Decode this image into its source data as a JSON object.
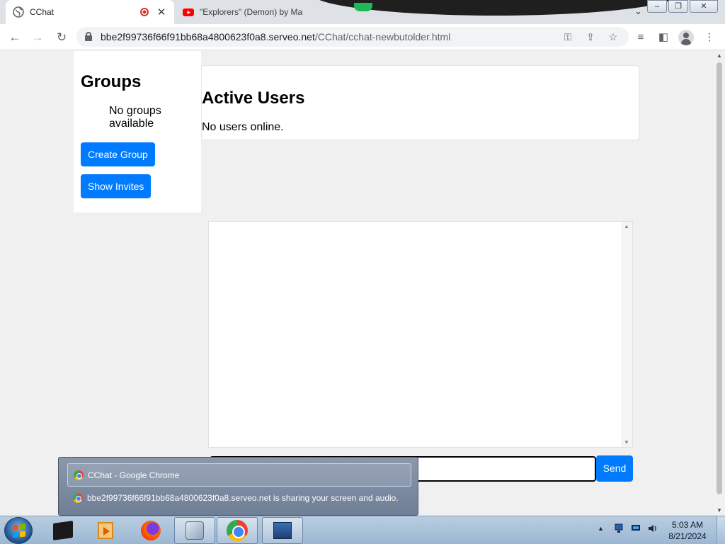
{
  "browser": {
    "tabs": [
      {
        "title": "CChat",
        "recording": true
      },
      {
        "title": "\"Explorers\" (Demon) by Ma"
      }
    ],
    "address": {
      "host": "bbe2f99736f66f91bb68a4800623f0a8.serveo.net",
      "path": "/CChat/cchat-newbutolder.html"
    }
  },
  "page": {
    "groups": {
      "title": "Groups",
      "empty_text": "No groups available",
      "create_label": "Create Group",
      "invites_label": "Show Invites"
    },
    "users": {
      "title": "Active Users",
      "empty_text": "No users online."
    },
    "composer": {
      "input_value": "",
      "send_label": "Send"
    }
  },
  "share_preview": {
    "window_title": "CChat - Google Chrome",
    "sharing_notice": "bbe2f99736f66f91bb68a4800623f0a8.serveo.net is sharing your screen and audio."
  },
  "taskbar": {
    "time": "5:03 AM",
    "date": "8/21/2024"
  },
  "colors": {
    "button_primary": "#007bff",
    "recording_red": "#d93025"
  }
}
